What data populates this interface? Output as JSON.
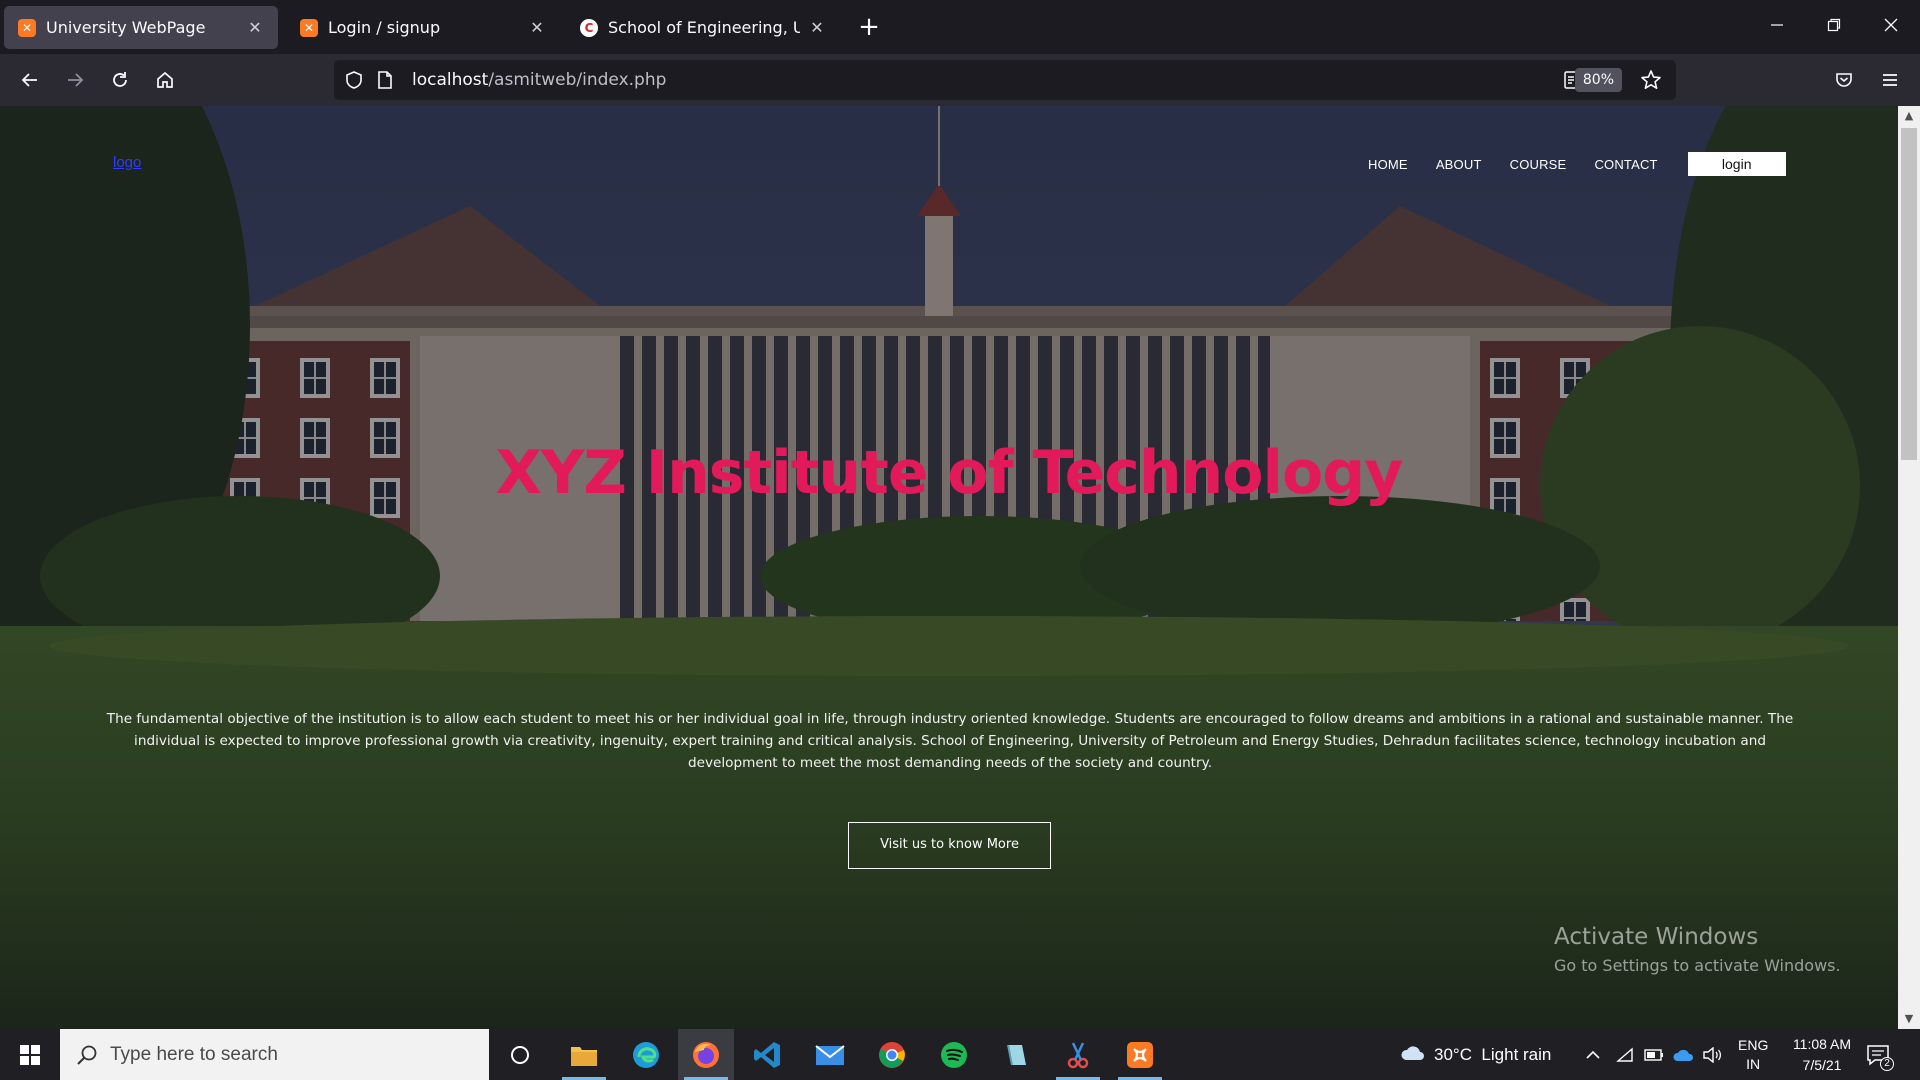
{
  "browser": {
    "tabs": [
      {
        "title": "University WebPage",
        "favicon": "xampp-icon",
        "active": true
      },
      {
        "title": "Login / signup",
        "favicon": "xampp-icon",
        "active": false
      },
      {
        "title": "School of Engineering, UPES De",
        "favicon": "upes-icon",
        "active": false
      }
    ],
    "new_tab_label": "+",
    "url_host": "localhost",
    "url_path": "/asmitweb/index.php",
    "zoom": "80%"
  },
  "site": {
    "logo_text": "logo",
    "menu": [
      "HOME",
      "ABOUT",
      "COURSE",
      "CONTACT"
    ],
    "login_label": "login",
    "hero_title": "XYZ Institute of Technology",
    "hero_description": "The fundamental objective of the institution is to allow each student to meet his or her individual goal in life, through industry oriented knowledge. Students are encouraged to follow dreams and ambitions in a rational and sustainable manner. The individual is expected to improve professional growth via creativity, ingenuity, expert training and critical analysis. School of Engineering, University of Petroleum and Energy Studies, Dehradun facilitates science, technology incubation and development to meet the most demanding needs of the society and country.",
    "cta_label": "Visit us to know More",
    "title_color": "#e31a5a"
  },
  "watermark": {
    "line1": "Activate Windows",
    "line2": "Go to Settings to activate Windows."
  },
  "taskbar": {
    "search_placeholder": "Type here to search",
    "apps": [
      "cortana-icon",
      "file-explorer-icon",
      "edge-icon",
      "firefox-icon",
      "vscode-icon",
      "mail-icon",
      "chrome-icon",
      "spotify-icon",
      "notepad-icon",
      "snipping-tool-icon",
      "xampp-icon"
    ],
    "weather": "30°C  Light rain",
    "language_top": "ENG",
    "language_bottom": "IN",
    "time": "11:08 AM",
    "date": "7/5/21",
    "notification_count": "2"
  }
}
